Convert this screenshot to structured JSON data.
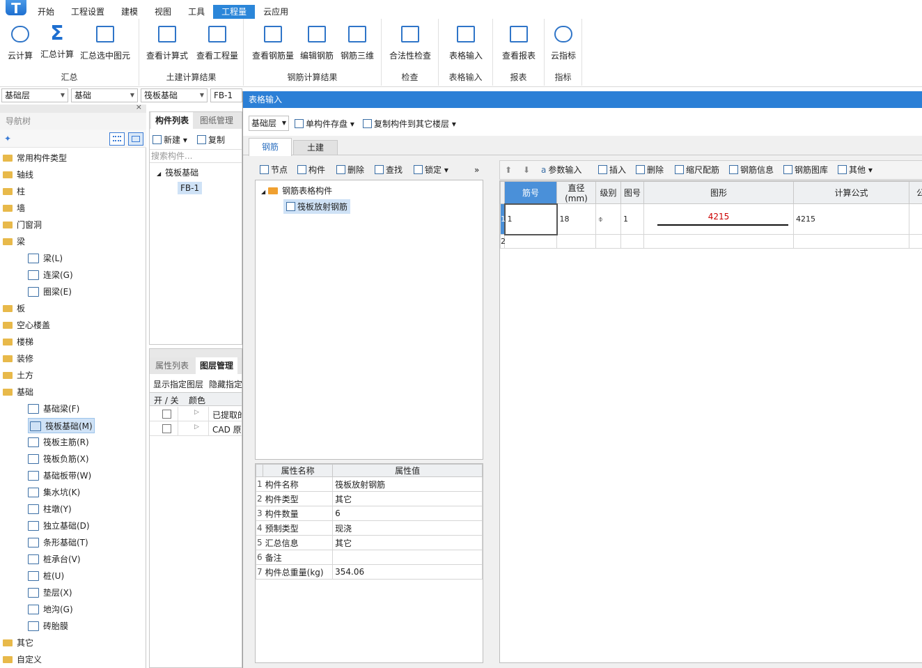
{
  "app": {
    "logo_letter": "T",
    "title_text": "...  —  ...  [...]"
  },
  "menu": [
    "开始",
    "工程设置",
    "建模",
    "视图",
    "工具",
    "工程量",
    "云应用"
  ],
  "menu_active": "工程量",
  "ribbon": {
    "groups": [
      {
        "label": "汇总",
        "buttons": [
          "云计算",
          "汇总计算",
          "汇总选中图元"
        ]
      },
      {
        "label": "土建计算结果",
        "buttons": [
          "查看计算式",
          "查看工程量"
        ]
      },
      {
        "label": "钢筋计算结果",
        "buttons": [
          "查看钢筋量",
          "编辑钢筋",
          "钢筋三维"
        ]
      },
      {
        "label": "检查",
        "buttons": [
          "合法性检查"
        ]
      },
      {
        "label": "表格输入",
        "buttons": [
          "表格输入"
        ]
      },
      {
        "label": "报表",
        "buttons": [
          "查看报表"
        ]
      },
      {
        "label": "指标",
        "buttons": [
          "云指标"
        ]
      }
    ]
  },
  "combos": {
    "floor": "基础层",
    "category": "基础",
    "type": "筏板基础",
    "name": "FB-1"
  },
  "nav": {
    "title": "导航树",
    "close": "×",
    "items": [
      {
        "label": "常用构件类型",
        "level": 0
      },
      {
        "label": "轴线",
        "level": 0
      },
      {
        "label": "柱",
        "level": 0
      },
      {
        "label": "墙",
        "level": 0
      },
      {
        "label": "门窗洞",
        "level": 0
      },
      {
        "label": "梁",
        "level": 0
      },
      {
        "label": "梁(L)",
        "level": 1
      },
      {
        "label": "连梁(G)",
        "level": 1
      },
      {
        "label": "圈梁(E)",
        "level": 1
      },
      {
        "label": "板",
        "level": 0
      },
      {
        "label": "空心楼盖",
        "level": 0
      },
      {
        "label": "楼梯",
        "level": 0
      },
      {
        "label": "装修",
        "level": 0
      },
      {
        "label": "土方",
        "level": 0
      },
      {
        "label": "基础",
        "level": 0
      },
      {
        "label": "基础梁(F)",
        "level": 1
      },
      {
        "label": "筏板基础(M)",
        "level": 1,
        "selected": true
      },
      {
        "label": "筏板主筋(R)",
        "level": 1
      },
      {
        "label": "筏板负筋(X)",
        "level": 1
      },
      {
        "label": "基础板带(W)",
        "level": 1
      },
      {
        "label": "集水坑(K)",
        "level": 1
      },
      {
        "label": "柱墩(Y)",
        "level": 1
      },
      {
        "label": "独立基础(D)",
        "level": 1
      },
      {
        "label": "条形基础(T)",
        "level": 1
      },
      {
        "label": "桩承台(V)",
        "level": 1
      },
      {
        "label": "桩(U)",
        "level": 1
      },
      {
        "label": "垫层(X)",
        "level": 1
      },
      {
        "label": "地沟(G)",
        "level": 1
      },
      {
        "label": "砖胎膜",
        "level": 1
      },
      {
        "label": "其它",
        "level": 0
      },
      {
        "label": "自定义",
        "level": 0
      }
    ]
  },
  "complist": {
    "tabs": [
      "构件列表",
      "图纸管理"
    ],
    "new_label": "新建",
    "copy_label": "复制",
    "search_placeholder": "搜索构件...",
    "tree_root": "筏板基础",
    "tree_item": "FB-1"
  },
  "layer": {
    "tabs": [
      "属性列表",
      "图层管理"
    ],
    "show_label": "显示指定图层",
    "hide_label": "隐藏指定",
    "col_onoff": "开 / 关",
    "col_color": "颜色",
    "rows": [
      "已提取的",
      "CAD 原"
    ]
  },
  "tablewin": {
    "title": "表格输入",
    "floor": "基础层",
    "save_label": "单构件存盘",
    "copy_label": "复制构件到其它楼层",
    "tabs": [
      "钢筋",
      "土建"
    ],
    "left_toolbar": [
      "节点",
      "构件",
      "删除",
      "查找",
      "锁定"
    ],
    "more": "»",
    "tree_root": "钢筋表格构件",
    "tree_item": "筏板放射钢筋",
    "prop_headers": [
      "属性名称",
      "属性值"
    ],
    "props": [
      {
        "n": "1",
        "name": "构件名称",
        "value": "筏板放射钢筋"
      },
      {
        "n": "2",
        "name": "构件类型",
        "value": "其它"
      },
      {
        "n": "3",
        "name": "构件数量",
        "value": "6"
      },
      {
        "n": "4",
        "name": "预制类型",
        "value": "现浇"
      },
      {
        "n": "5",
        "name": "汇总信息",
        "value": "其它"
      },
      {
        "n": "6",
        "name": "备注",
        "value": ""
      },
      {
        "n": "7",
        "name": "构件总重量(kg)",
        "value": "354.06"
      }
    ],
    "right_toolbar": [
      "参数输入",
      "插入",
      "删除",
      "缩尺配筋",
      "钢筋信息",
      "钢筋图库",
      "其他"
    ],
    "grid_headers": [
      "筋号",
      "直径(mm)",
      "级别",
      "图号",
      "图形",
      "计算公式",
      "公"
    ],
    "grid_rows": [
      {
        "row": "1",
        "jinhao": "1",
        "dia": "18",
        "grade": "⌽",
        "fig": "1",
        "shape_len": "4215",
        "formula": "4215"
      },
      {
        "row": "2",
        "jinhao": "",
        "dia": "",
        "grade": "",
        "fig": "",
        "shape_len": "",
        "formula": ""
      }
    ]
  },
  "colors": {
    "accent": "#2b7fd6",
    "shape_text": "#cc0000",
    "folder": "#e8b94a"
  }
}
